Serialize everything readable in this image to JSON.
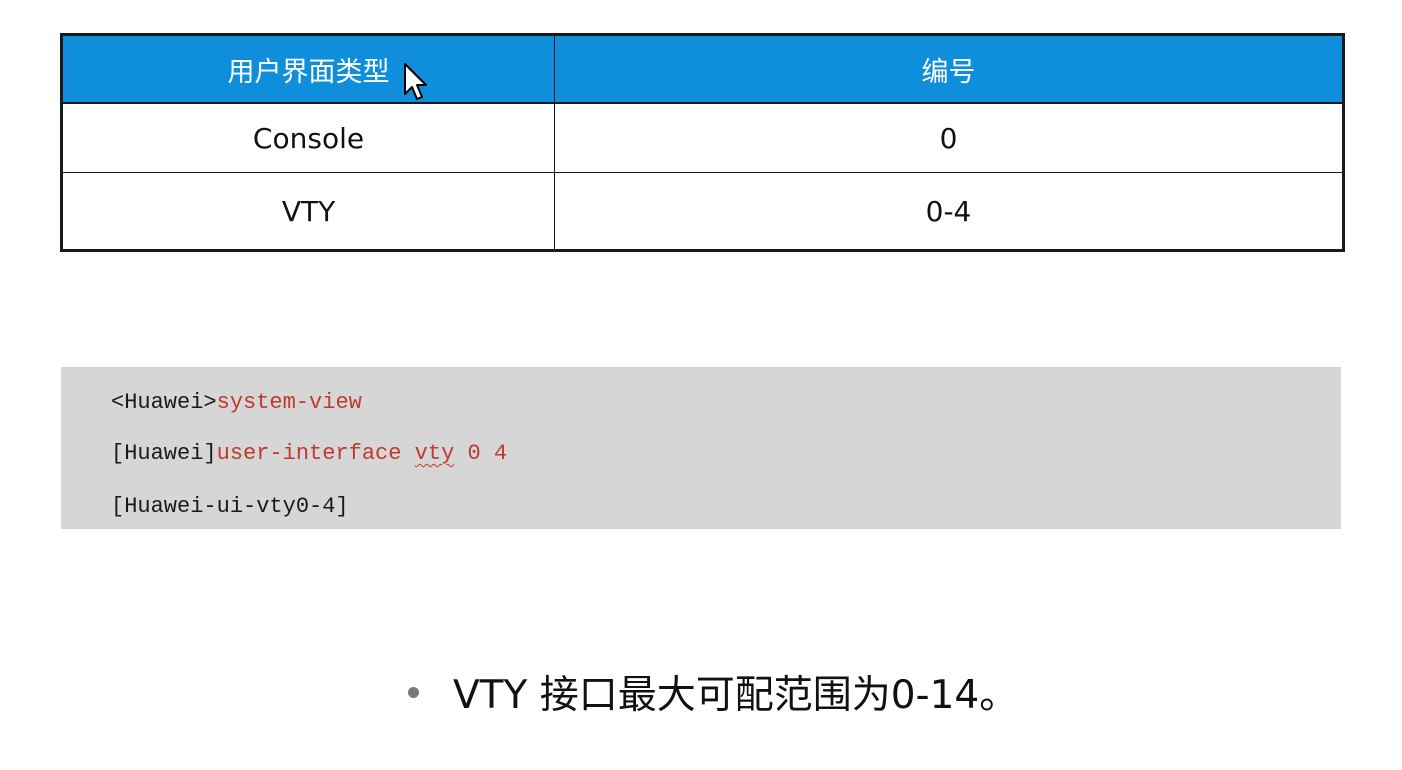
{
  "table": {
    "header": {
      "type_label": "用户界面类型",
      "number_label": "编号",
      "header_color": "#0f8fdb"
    },
    "rows": [
      {
        "type": "Console",
        "number": "0"
      },
      {
        "type": "VTY",
        "number": "0-4"
      }
    ]
  },
  "code": {
    "line1": {
      "prompt": "<Huawei>",
      "command": "system-view"
    },
    "line2": {
      "prompt": "[Huawei]",
      "command": "user-interface ",
      "keyword": "vty",
      "args": " 0 4"
    },
    "line3": {
      "prompt": "[Huawei-ui-vty0-4]"
    },
    "command_color": "#c0392b",
    "background_color": "#d6d6d6"
  },
  "note": {
    "text": "VTY 接口最大可配范围为0-14。"
  },
  "cursor": {
    "icon": "mouse-pointer-icon"
  }
}
